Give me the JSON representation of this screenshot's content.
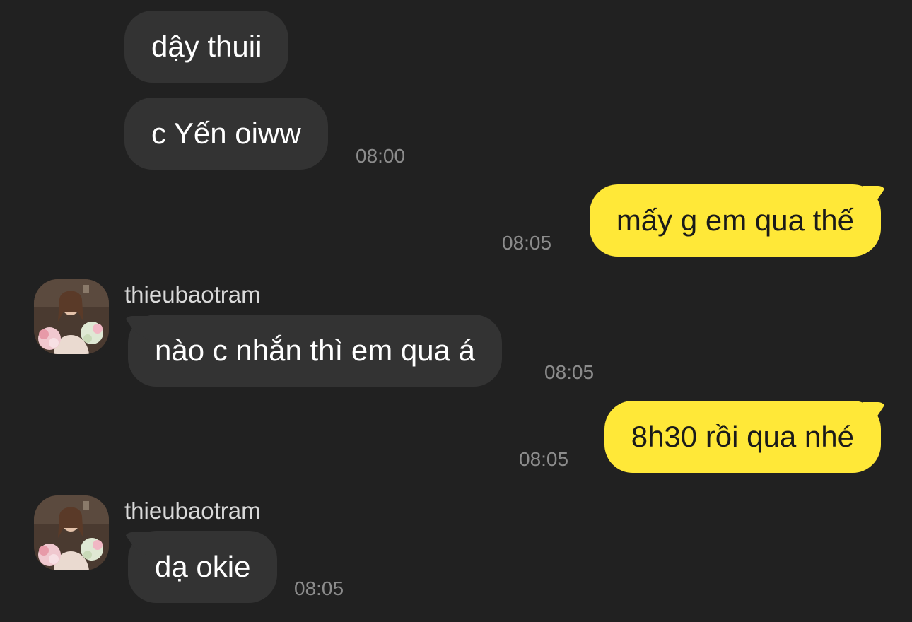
{
  "conversation": {
    "messages": [
      {
        "direction": "incoming",
        "text": "dậy thuii"
      },
      {
        "direction": "incoming",
        "text": "c Yến oiww",
        "time": "08:00"
      },
      {
        "direction": "outgoing",
        "text": "mấy g em qua thế",
        "time": "08:05"
      },
      {
        "direction": "incoming",
        "sender": "thieubaotram",
        "avatar_icon": "user-avatar",
        "text": "nào c nhắn thì em qua á",
        "time": "08:05"
      },
      {
        "direction": "outgoing",
        "text": "8h30 rồi qua nhé",
        "time": "08:05"
      },
      {
        "direction": "incoming",
        "sender": "thieubaotram",
        "avatar_icon": "user-avatar",
        "text": "dạ okie",
        "time": "08:05"
      }
    ]
  },
  "colors": {
    "background": "#212121",
    "incoming_bubble": "#333333",
    "outgoing_bubble": "#ffe838",
    "timestamp": "#8c8c8c"
  }
}
